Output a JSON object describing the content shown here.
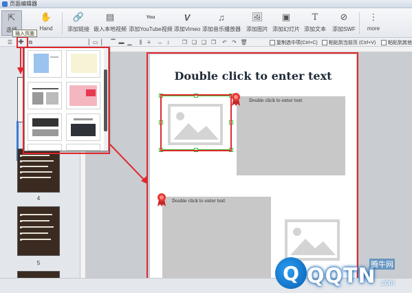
{
  "window": {
    "title": "页面编辑器"
  },
  "toolbar": {
    "items": [
      {
        "label": "选择",
        "icon": "select-cursor-icon"
      },
      {
        "label": "Hand",
        "icon": "hand-icon"
      },
      {
        "label": "添加链接",
        "icon": "link-icon"
      },
      {
        "label": "嵌入本地视频",
        "icon": "film-icon"
      },
      {
        "label": "添加YouTube视频",
        "icon": "youtube-icon"
      },
      {
        "label": "添加Vimeo",
        "icon": "vimeo-icon"
      },
      {
        "label": "添加音乐播放器",
        "icon": "music-note-icon"
      },
      {
        "label": "添加图片",
        "icon": "image-icon"
      },
      {
        "label": "添加幻灯片",
        "icon": "slideshow-icon"
      },
      {
        "label": "添加文本",
        "icon": "text-t-icon"
      },
      {
        "label": "添加SWF",
        "icon": "swf-icon"
      },
      {
        "label": "more",
        "icon": "more-icon"
      }
    ]
  },
  "toolbar2": {
    "copy_label": "复制选中项(Ctrl+C)",
    "paste_current_label": "粘贴到当前页 (Ctrl+V)",
    "paste_other_label": "粘贴到其他"
  },
  "tooltip": {
    "text": "插入页面"
  },
  "sidebar": {
    "page_numbers": [
      "4",
      "5"
    ]
  },
  "canvas": {
    "title": "Double click to enter text",
    "caption_top": "Double click to enter text",
    "caption_bottom": "Double click to enter text"
  },
  "watermark": {
    "brand": "QQTN",
    "cn": "腾牛网",
    "com": ".com"
  },
  "colors": {
    "highlight_red": "#e0282e",
    "selection_green": "#35c235",
    "accent_blue": "#3a7bd5"
  }
}
